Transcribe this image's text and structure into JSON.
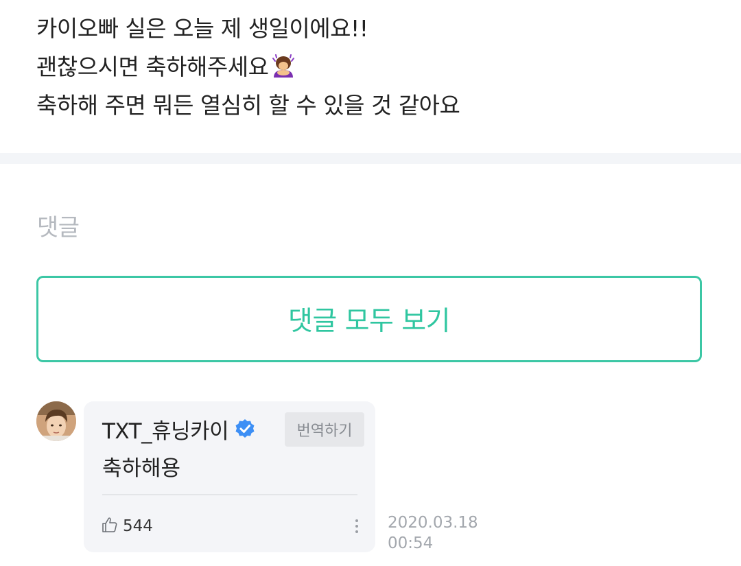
{
  "post": {
    "lines": [
      "카이오빠 실은 오늘 제 생일이에요!!",
      "괜찮으시면 축하해주세요",
      "축하해 주면 뭐든 열심히 할 수 있을 것 같아요"
    ],
    "emoji": "person-bowing-emoji"
  },
  "comments": {
    "heading": "댓글",
    "view_all_label": "댓글 모두 보기",
    "accent_color": "#3cc7a5",
    "items": [
      {
        "author": "TXT_휴닝카이",
        "verified": true,
        "translate_label": "번역하기",
        "text": "축하해용",
        "likes": "544",
        "date": "2020.03.18",
        "time": "00:54"
      }
    ]
  }
}
